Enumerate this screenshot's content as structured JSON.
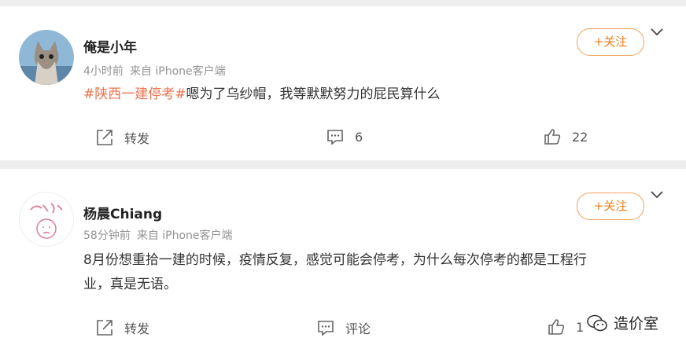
{
  "posts": [
    {
      "user": "俺是小年",
      "time": "4小时前",
      "source": "来自 iPhone客户端",
      "follow_label": "+关注",
      "tag": "#陕西一建停考#",
      "text": "嗯为了乌纱帽，我等默默努力的屁民算什么",
      "repost_label": "转发",
      "comment_label": "6",
      "like_count": "22"
    },
    {
      "user": "杨晨Chiang",
      "time": "58分钟前",
      "source": "来自 iPhone客户端",
      "follow_label": "+关注",
      "text_line1": "8月份想重拾一建的时候，疫情反复，感觉可能会停考，为什么每次停考的都是工程行",
      "text_line2": "业，真是无语。",
      "repost_label": "转发",
      "comment_label": "评论",
      "like_count": "1"
    }
  ],
  "watermark": {
    "text": "造价室"
  },
  "colors": {
    "accent": "#f07f16",
    "tag": "#eb7350",
    "meta": "#939393",
    "background": "#eeeeee"
  }
}
